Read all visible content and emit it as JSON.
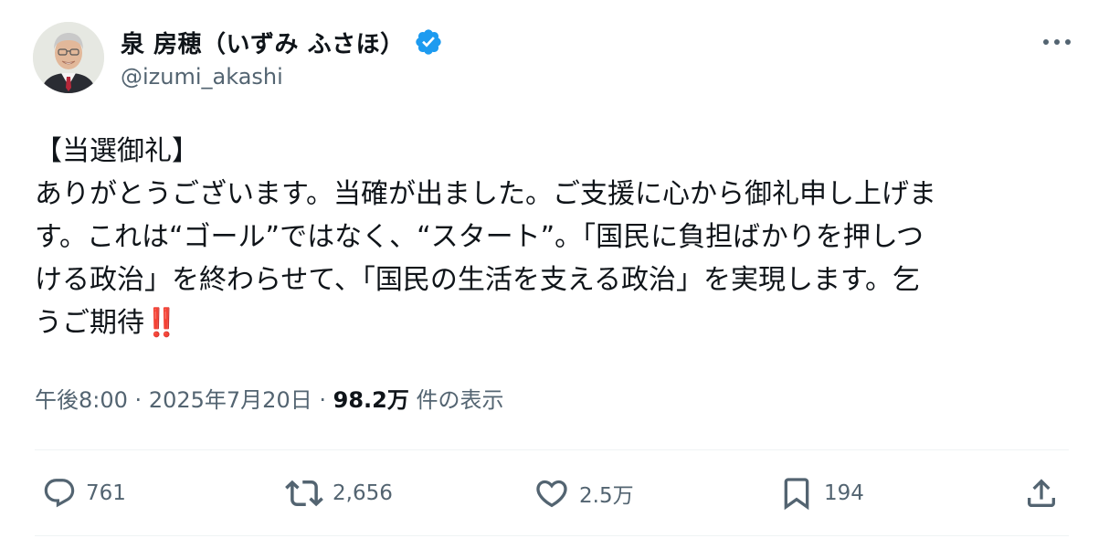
{
  "author": {
    "display_name": "泉 房穂（いずみ ふさほ）",
    "handle": "@izumi_akashi",
    "verified": true
  },
  "tweet": {
    "lines": [
      "【当選御礼】",
      "ありがとうございます。当確が出ました。ご支援に心から御礼申し上げま",
      "す。これは“ゴール”ではなく、“スタート”。「国民に負担ばかりを押しつ",
      "ける政治」を終わらせて、「国民の生活を支える政治」を実現します。乞",
      "うご期待"
    ],
    "trailing_emoji": "‼️"
  },
  "meta": {
    "time": "午後8:00",
    "separator": "·",
    "date": "2025年7月20日",
    "views_count": "98.2万",
    "views_label": "件の表示"
  },
  "stats": {
    "replies": "761",
    "retweets": "2,656",
    "likes": "2.5万",
    "bookmarks": "194"
  },
  "icons": {
    "verified": "verified-badge-icon",
    "more": "more-options-icon",
    "reply": "reply-icon",
    "retweet": "retweet-icon",
    "like": "heart-icon",
    "bookmark": "bookmark-icon",
    "share": "share-icon"
  },
  "colors": {
    "text": "#0f1419",
    "secondary": "#536471",
    "verified": "#1d9bf0",
    "emoji_red": "#e0202b"
  }
}
